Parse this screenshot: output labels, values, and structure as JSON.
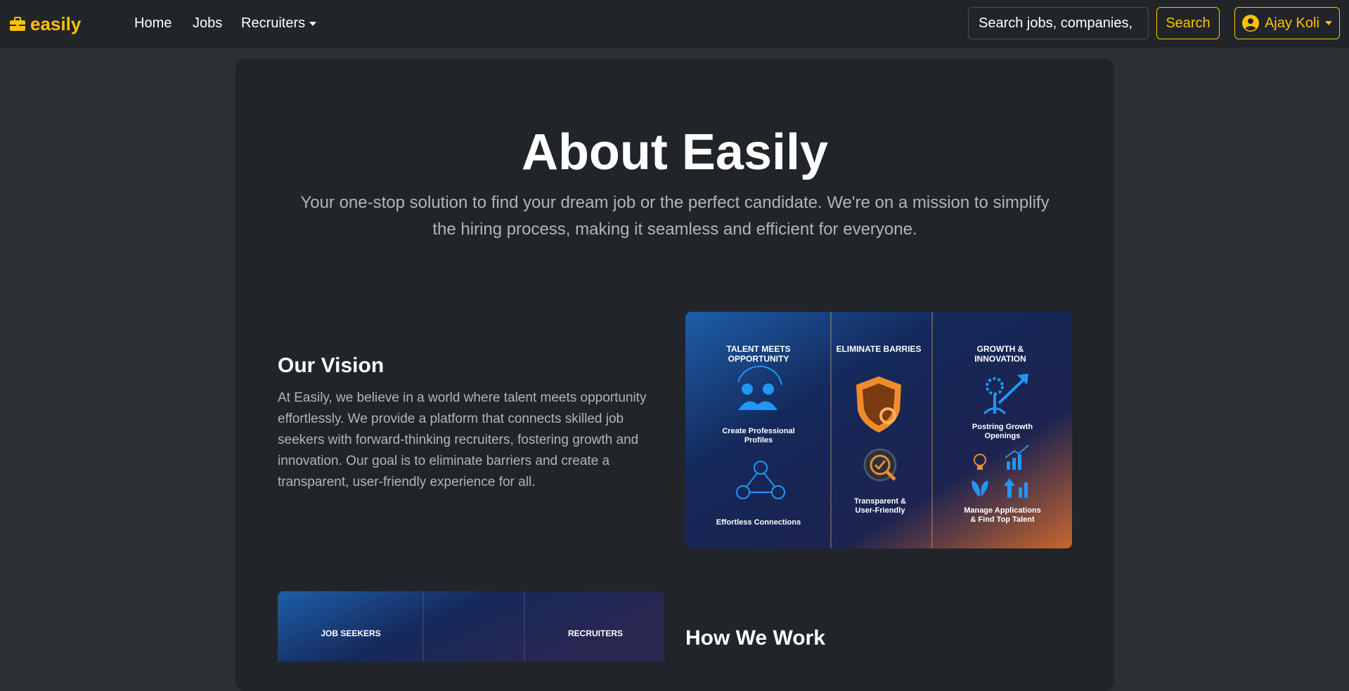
{
  "nav": {
    "brand": "easily",
    "links": [
      "Home",
      "Jobs",
      "Recruiters"
    ],
    "search_placeholder": "Search jobs, companies,",
    "search_button": "Search",
    "user_name": "Ajay Koli"
  },
  "about": {
    "title": "About Easily",
    "subtitle": "Your one-stop solution to find your dream job or the perfect candidate. We're on a mission to simplify the hiring process, making it seamless and efficient for everyone."
  },
  "vision": {
    "title": "Our Vision",
    "text": "At Easily, we believe in a world where talent meets opportunity effortlessly. We provide a platform that connects skilled job seekers with forward-thinking recruiters, fostering growth and innovation. Our goal is to eliminate barriers and create a transparent, user-friendly experience for all."
  },
  "vision_image": {
    "col1_title_1": "TALENT MEETS",
    "col1_title_2": "OPPORTUNITY",
    "col1_item1_1": "Create Professional",
    "col1_item1_2": "Profiles",
    "col1_item2": "Effortless Connections",
    "col2_title": "ELIMINATE BARRIES",
    "col2_item_1": "Transparent &",
    "col2_item_2": "User-Friendly",
    "col3_title_1": "GROWTH &",
    "col3_title_2": "INNOVATION",
    "col3_item1_1": "Postring Growth",
    "col3_item1_2": "Openings",
    "col3_item2_1": "Manage Applications",
    "col3_item2_2": "& Find Top Talent"
  },
  "how_image": {
    "left_label": "JOB SEEKERS",
    "right_label": "RECRUITERS"
  },
  "how": {
    "title": "How We Work"
  },
  "colors": {
    "accent": "#ffc107",
    "navbar_bg": "#212529",
    "page_bg": "#2b3035",
    "card_bg": "#212529",
    "muted_text": "#adb5bd",
    "icon_blue": "#2196f3",
    "icon_orange": "#f08c2c"
  },
  "icons": {
    "brand": "briefcase-icon",
    "user": "user-circle-icon",
    "dropdown": "caret-down-icon"
  }
}
